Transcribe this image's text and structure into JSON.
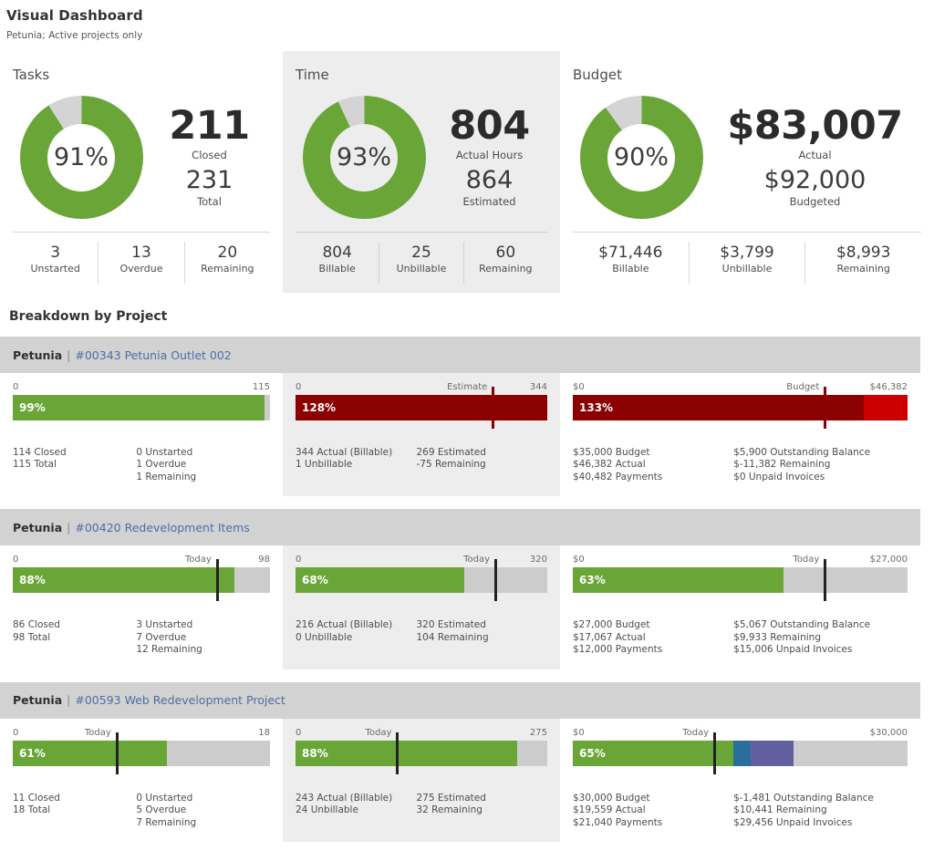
{
  "header": {
    "title": "Visual Dashboard",
    "subtitle": "Petunia; Active projects only"
  },
  "colors": {
    "green": "#6aa637",
    "gray": "#cccccc",
    "dark_red": "#8b0000",
    "bright_red": "#cc0000",
    "blue": "#2a6e9e",
    "purple": "#615f9e",
    "link": "#4a6fa5",
    "header_band": "#d2d2d2",
    "alt_column": "#ededed"
  },
  "summary": {
    "tasks": {
      "title": "Tasks",
      "donut_pct": "91%",
      "donut_value": 91,
      "primary_value": "211",
      "primary_label": "Closed",
      "secondary_value": "231",
      "secondary_label": "Total",
      "foot": [
        {
          "value": "3",
          "label": "Unstarted"
        },
        {
          "value": "13",
          "label": "Overdue"
        },
        {
          "value": "20",
          "label": "Remaining"
        }
      ]
    },
    "time": {
      "title": "Time",
      "donut_pct": "93%",
      "donut_value": 93,
      "primary_value": "804",
      "primary_label": "Actual Hours",
      "secondary_value": "864",
      "secondary_label": "Estimated",
      "foot": [
        {
          "value": "804",
          "label": "Billable"
        },
        {
          "value": "25",
          "label": "Unbillable"
        },
        {
          "value": "60",
          "label": "Remaining"
        }
      ]
    },
    "budget": {
      "title": "Budget",
      "donut_pct": "90%",
      "donut_value": 90,
      "primary_value": "$83,007",
      "primary_label": "Actual",
      "secondary_value": "$92,000",
      "secondary_label": "Budgeted",
      "foot": [
        {
          "value": "$71,446",
          "label": "Billable"
        },
        {
          "value": "$3,799",
          "label": "Unbillable"
        },
        {
          "value": "$8,993",
          "label": "Remaining"
        }
      ]
    }
  },
  "breakdown": {
    "title": "Breakdown by Project",
    "projects": [
      {
        "client": "Petunia",
        "separator": "|",
        "link": "#00343 Petunia Outlet 002",
        "tasks": {
          "axis_left": "0",
          "axis_mid": "",
          "axis_right": "115",
          "pct_label": "99%",
          "fill_pct": 98,
          "marker_pct": null,
          "fill_color": "#6aa637",
          "stats_left": [
            "114 Closed",
            "115 Total"
          ],
          "stats_right": [
            "0 Unstarted",
            "1 Overdue",
            "1 Remaining"
          ]
        },
        "time": {
          "axis_left": "0",
          "axis_mid": "Estimate",
          "axis_right": "344",
          "pct_label": "128%",
          "fill_pct": 100,
          "marker_pct": 78,
          "marker_color": "#8b0000",
          "fill_color": "#8b0000",
          "stats_left": [
            "344 Actual (Billable)",
            "1 Unbillable"
          ],
          "stats_right": [
            "269 Estimated",
            "-75 Remaining"
          ]
        },
        "budget": {
          "axis_left": "$0",
          "axis_mid": "Budget",
          "axis_right": "$46,382",
          "pct_label": "133%",
          "fill_pct": 87,
          "second_pct": 13,
          "marker_pct": 75,
          "marker_color": "#8b0000",
          "fill_color": "#8b0000",
          "second_color": "#cc0000",
          "stats_left": [
            "$35,000 Budget",
            "$46,382 Actual",
            "$40,482 Payments"
          ],
          "stats_right": [
            "$5,900 Outstanding Balance",
            "$-11,382 Remaining",
            "$0 Unpaid Invoices"
          ]
        }
      },
      {
        "client": "Petunia",
        "separator": "|",
        "link": "#00420 Redevelopment Items",
        "tasks": {
          "axis_left": "0",
          "axis_mid": "Today",
          "axis_right": "98",
          "pct_label": "88%",
          "fill_pct": 86,
          "marker_pct": 79,
          "marker_color": "#222222",
          "fill_color": "#6aa637",
          "stats_left": [
            "86 Closed",
            "98 Total"
          ],
          "stats_right": [
            "3 Unstarted",
            "7 Overdue",
            "12 Remaining"
          ]
        },
        "time": {
          "axis_left": "0",
          "axis_mid": "Today",
          "axis_right": "320",
          "pct_label": "68%",
          "fill_pct": 67,
          "marker_pct": 79,
          "marker_color": "#222222",
          "fill_color": "#6aa637",
          "stats_left": [
            "216 Actual (Billable)",
            "0 Unbillable"
          ],
          "stats_right": [
            "320 Estimated",
            "104 Remaining"
          ]
        },
        "budget": {
          "axis_left": "$0",
          "axis_mid": "Today",
          "axis_right": "$27,000",
          "pct_label": "63%",
          "fill_pct": 63,
          "second_pct": 0,
          "marker_pct": 75,
          "marker_color": "#222222",
          "fill_color": "#6aa637",
          "stats_left": [
            "$27,000 Budget",
            "$17,067 Actual",
            "$12,000 Payments"
          ],
          "stats_right": [
            "$5,067 Outstanding Balance",
            "$9,933 Remaining",
            "$15,006 Unpaid Invoices"
          ]
        }
      },
      {
        "client": "Petunia",
        "separator": "|",
        "link": "#00593 Web Redevelopment Project",
        "tasks": {
          "axis_left": "0",
          "axis_mid": "Today",
          "axis_right": "18",
          "pct_label": "61%",
          "fill_pct": 60,
          "marker_pct": 40,
          "marker_color": "#222222",
          "fill_color": "#6aa637",
          "stats_left": [
            "11 Closed",
            "18 Total"
          ],
          "stats_right": [
            "0 Unstarted",
            "5 Overdue",
            "7 Remaining"
          ]
        },
        "time": {
          "axis_left": "0",
          "axis_mid": "Today",
          "axis_right": "275",
          "pct_label": "88%",
          "fill_pct": 88,
          "marker_pct": 40,
          "marker_color": "#222222",
          "fill_color": "#6aa637",
          "stats_left": [
            "243 Actual (Billable)",
            "24 Unbillable"
          ],
          "stats_right": [
            "275 Estimated",
            "32 Remaining"
          ]
        },
        "budget": {
          "axis_left": "$0",
          "axis_mid": "Today",
          "axis_right": "$30,000",
          "pct_label": "65%",
          "fill_pct": 48,
          "second_pct": 5,
          "third_pct": 13,
          "marker_pct": 42,
          "marker_color": "#222222",
          "fill_color": "#6aa637",
          "second_color": "#2a6e9e",
          "third_color": "#615f9e",
          "stats_left": [
            "$30,000 Budget",
            "$19,559 Actual",
            "$21,040 Payments"
          ],
          "stats_right": [
            "$-1,481 Outstanding Balance",
            "$10,441 Remaining",
            "$29,456 Unpaid Invoices"
          ]
        }
      }
    ]
  }
}
